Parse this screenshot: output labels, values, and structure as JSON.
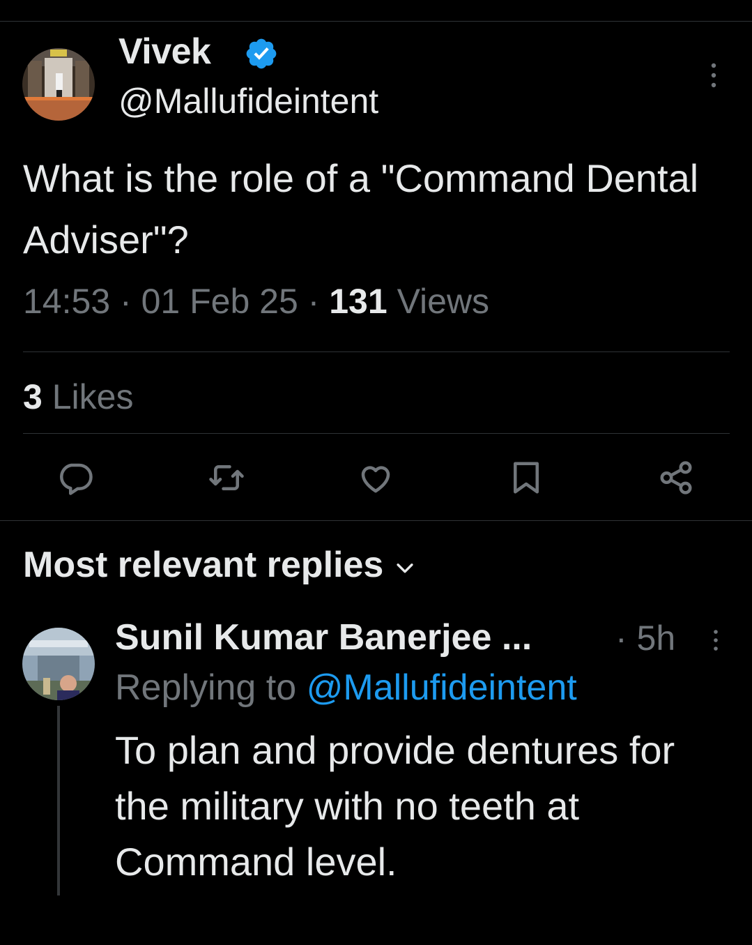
{
  "tweet": {
    "author_name": "Vivek",
    "author_handle": "@Mallufideintent",
    "verified": true,
    "text": "What is the role of a \"Command Dental Adviser\"?",
    "time": "14:53",
    "date": "01 Feb 25",
    "separator": "·",
    "views_count": "131",
    "views_label": "Views",
    "likes_count": "3",
    "likes_label": "Likes"
  },
  "actions": {
    "reply": "reply-icon",
    "retweet": "retweet-icon",
    "like": "heart-icon",
    "bookmark": "bookmark-icon",
    "share": "share-icon"
  },
  "replies_section": {
    "sort_label": "Most relevant replies"
  },
  "reply": {
    "author_name": "Sunil Kumar Banerjee ...",
    "time": "· 5h",
    "replying_to_label": "Replying to",
    "replying_to_handle": "@Mallufideintent",
    "text": "To plan and provide dentures for the military with no teeth at Command level."
  },
  "colors": {
    "background": "#000000",
    "text_primary": "#e7e9ea",
    "text_secondary": "#71767b",
    "accent": "#1d9bf0",
    "divider": "#2f3336"
  }
}
